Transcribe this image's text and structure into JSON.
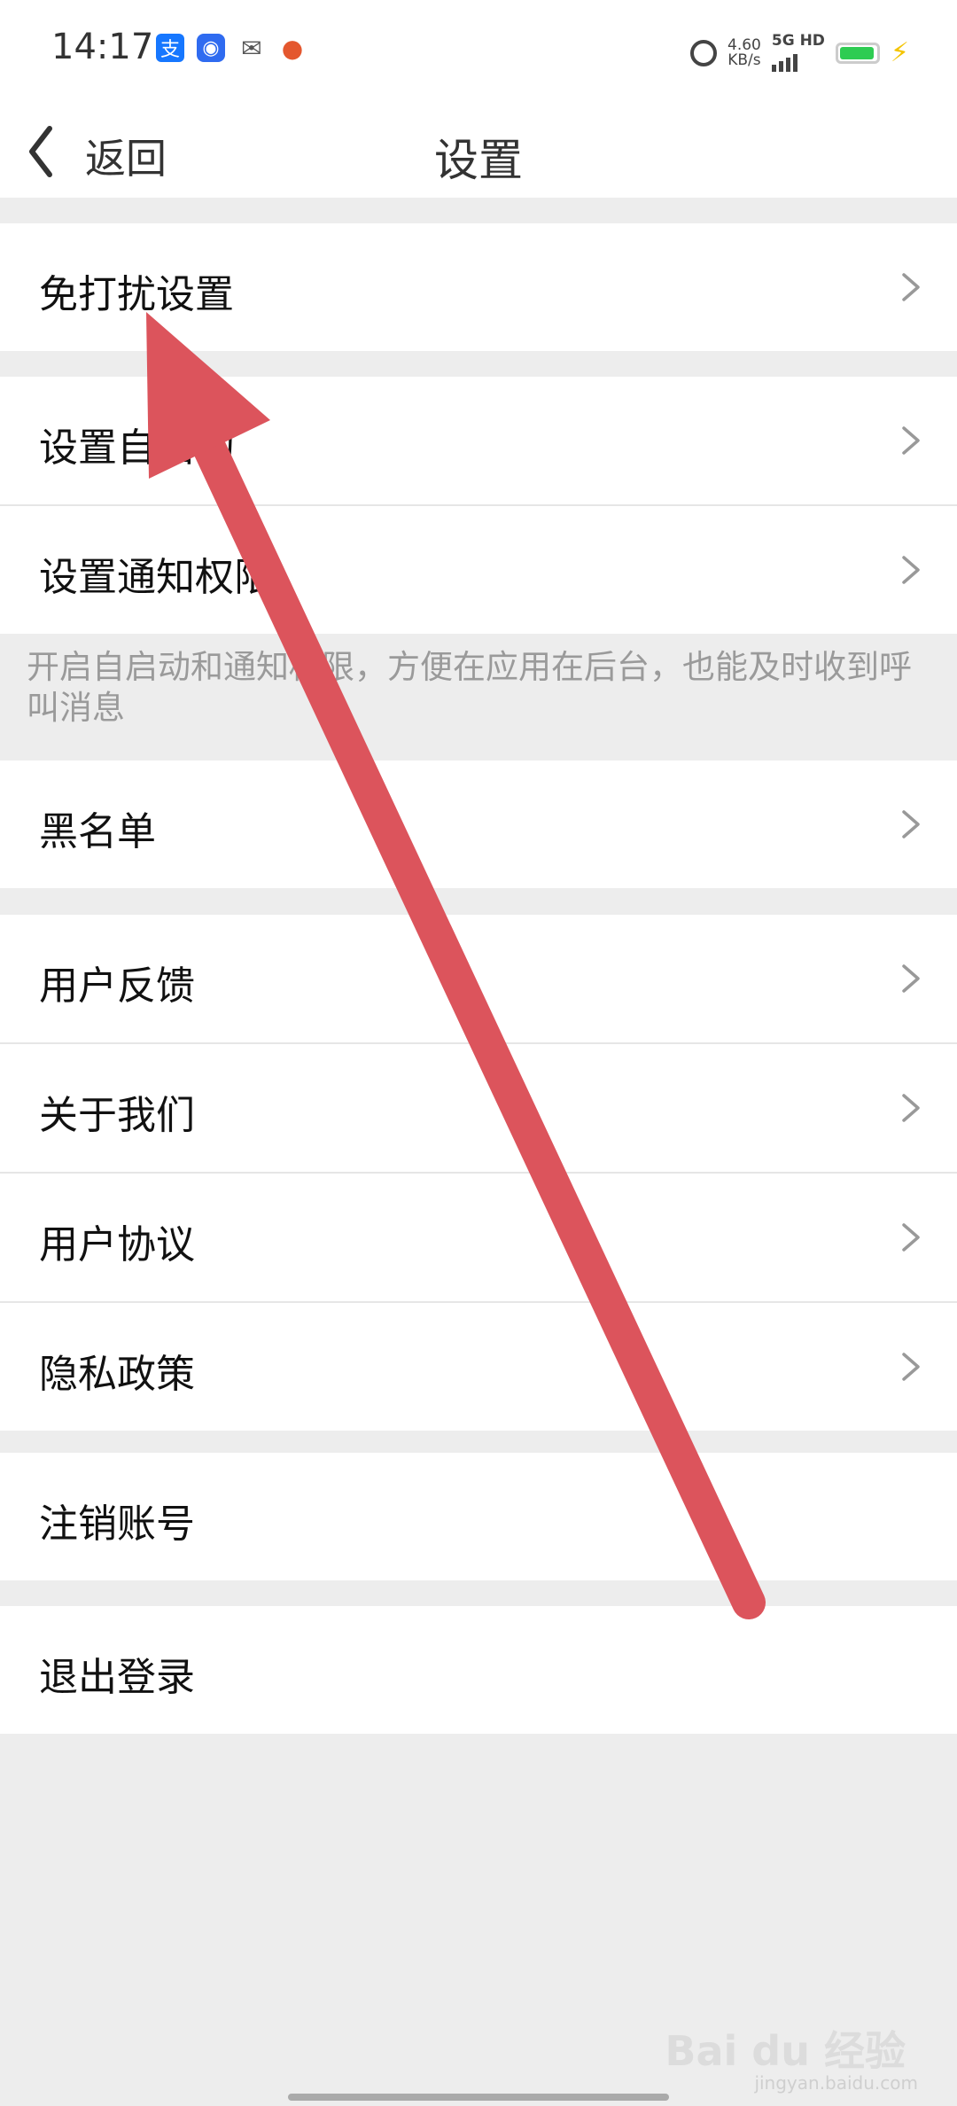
{
  "status_bar": {
    "time": "14:17",
    "app_icons": [
      "alipay-icon",
      "qq-icon",
      "wechat-icon",
      "app-icon"
    ],
    "alarm_icon": "alarm-icon",
    "speed_value": "4.60",
    "speed_unit": "KB/s",
    "network": "5G HD",
    "battery_color": "#2ecc52",
    "charging_icon": "bolt-icon"
  },
  "nav": {
    "back_label": "返回",
    "title": "设置"
  },
  "groups": [
    {
      "items": [
        {
          "label": "免打扰设置",
          "chevron": true
        }
      ]
    },
    {
      "items": [
        {
          "label": "设置自启动",
          "chevron": true
        },
        {
          "label": "设置通知权限",
          "chevron": true
        }
      ]
    },
    {
      "items": [
        {
          "label": "黑名单",
          "chevron": true
        }
      ]
    },
    {
      "items": [
        {
          "label": "用户反馈",
          "chevron": true
        },
        {
          "label": "关于我们",
          "chevron": true
        },
        {
          "label": "用户协议",
          "chevron": true
        },
        {
          "label": "隐私政策",
          "chevron": true
        }
      ]
    },
    {
      "items": [
        {
          "label": "注销账号",
          "chevron": false
        }
      ]
    },
    {
      "items": [
        {
          "label": "退出登录",
          "chevron": false
        }
      ]
    }
  ],
  "hint": "开启自启动和通知权限，方便在应用在后台，也能及时收到呼叫消息",
  "annotation_arrow_color": "#dc545c",
  "watermark": {
    "brand": "Bai du 经验",
    "sub": "jingyan.baidu.com"
  }
}
